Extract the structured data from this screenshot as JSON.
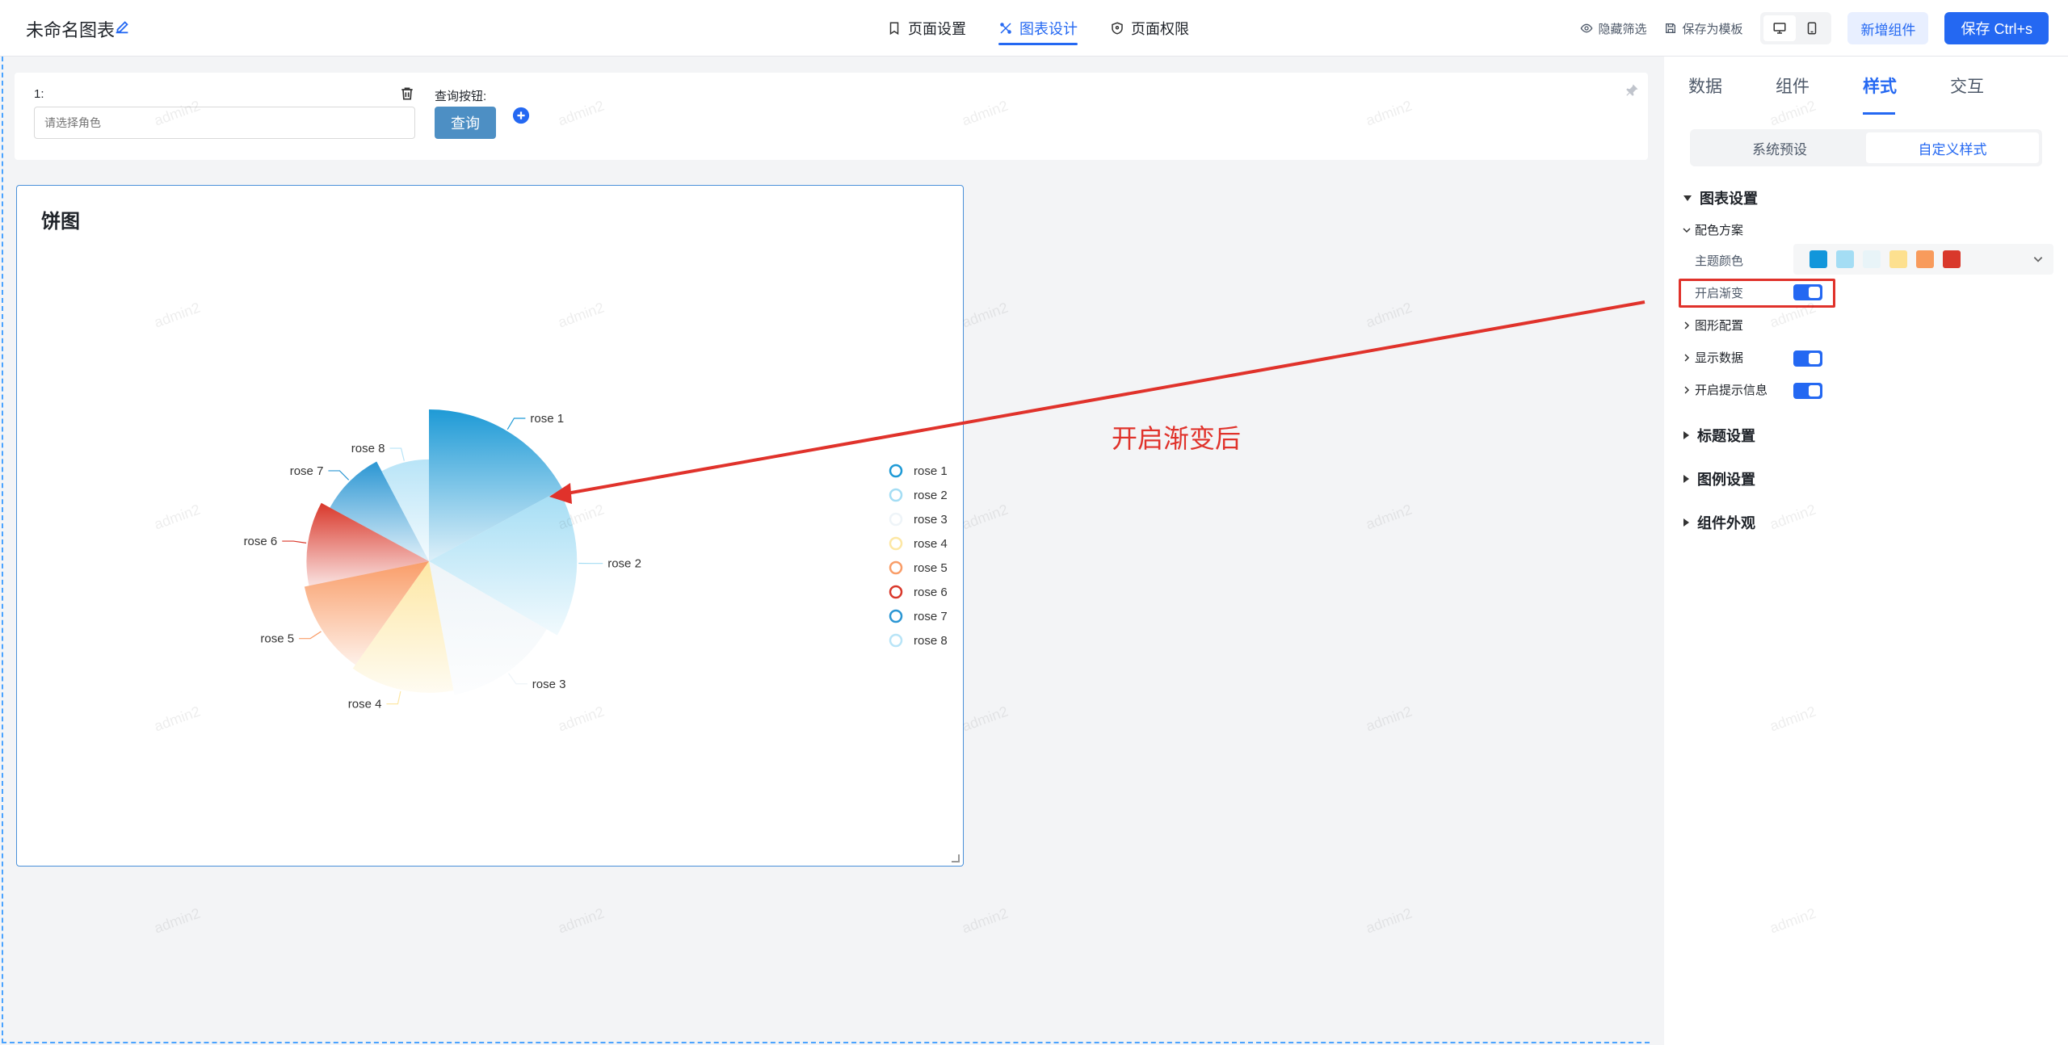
{
  "header": {
    "title": "未命名图表",
    "tabs": [
      {
        "label": "页面设置",
        "icon": "bookmark-icon"
      },
      {
        "label": "图表设计",
        "icon": "design-icon",
        "active": true
      },
      {
        "label": "页面权限",
        "icon": "shield-icon"
      }
    ],
    "hide_filter": "隐藏筛选",
    "save_template": "保存为模板",
    "add_component": "新增组件",
    "save": "保存 Ctrl+s"
  },
  "filter": {
    "label": "1:",
    "placeholder": "请选择角色",
    "query_label": "查询按钮:",
    "query_button": "查询"
  },
  "chart_card": {
    "title": "饼图"
  },
  "chart_data": {
    "type": "pie",
    "subtype": "rose-radius",
    "gradient": true,
    "categories": [
      "rose 1",
      "rose 2",
      "rose 3",
      "rose 4",
      "rose 5",
      "rose 6",
      "rose 7",
      "rose 8"
    ],
    "values": [
      40,
      38,
      32,
      30,
      28,
      26,
      22,
      18
    ],
    "colors": [
      "#1e9ad6",
      "#a4ddf4",
      "#eef4f8",
      "#fde7a4",
      "#f99d68",
      "#d9382b",
      "#2b96d3",
      "#b8e4f7"
    ],
    "legend": [
      "rose 1",
      "rose 2",
      "rose 3",
      "rose 4",
      "rose 5",
      "rose 6",
      "rose 7",
      "rose 8"
    ],
    "legend_position": "right"
  },
  "annotation": {
    "text": "开启渐变后"
  },
  "panel": {
    "tabs": [
      "数据",
      "组件",
      "样式",
      "交互"
    ],
    "active_tab": "样式",
    "segments": [
      "系统预设",
      "自定义样式"
    ],
    "chart_settings": "图表设置",
    "color_scheme": "配色方案",
    "theme_color": "主题颜色",
    "theme_swatches": [
      "#1296db",
      "#a4ddf4",
      "#e8f4f8",
      "#fde08f",
      "#f89b5c",
      "#d9382b"
    ],
    "gradient_toggle": "开启渐变",
    "shape_config": "图形配置",
    "show_data": "显示数据",
    "show_tooltip": "开启提示信息",
    "title_settings": "标题设置",
    "legend_settings": "图例设置",
    "component_appearance": "组件外观"
  },
  "watermark": "admin2"
}
